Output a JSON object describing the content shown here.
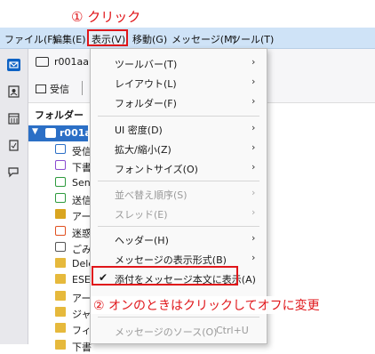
{
  "annotations": {
    "step1": "① クリック",
    "step2": "② オンのときはクリックしてオフに変更"
  },
  "menubar": {
    "file": "ファイル(F)",
    "edit": "編集(E)",
    "view": "表示(V)",
    "go": "移動(G)",
    "message": "メッセージ(M)",
    "tools": "ツール(T)"
  },
  "toolbar": {
    "account": "r001aa(",
    "get_messages": "受信"
  },
  "folders": {
    "header": "フォルダー",
    "account": "r001aa",
    "items": [
      {
        "label": "受信",
        "icon": "inbox-icon"
      },
      {
        "label": "下書",
        "icon": "drafts-icon"
      },
      {
        "label": "Sen",
        "icon": "sent-icon"
      },
      {
        "label": "送信",
        "icon": "sent-icon"
      },
      {
        "label": "アー",
        "icon": "archive-icon"
      },
      {
        "label": "迷惑",
        "icon": "junk-icon"
      },
      {
        "label": "ごみ",
        "icon": "trash-icon"
      },
      {
        "label": "Dele",
        "icon": "folder-icon"
      },
      {
        "label": "ESE",
        "icon": "folder-icon"
      },
      {
        "label": "アー",
        "icon": "folder-icon"
      },
      {
        "label": "ジャ",
        "icon": "folder-icon"
      },
      {
        "label": "フィ",
        "icon": "folder-icon"
      },
      {
        "label": "下書",
        "icon": "folder-icon"
      }
    ]
  },
  "view_menu": {
    "toolbar": "ツールバー(T)",
    "layout": "レイアウト(L)",
    "folder": "フォルダー(F)",
    "ui_density": "UI 密度(D)",
    "zoom": "拡大/縮小(Z)",
    "font_size": "フォントサイズ(O)",
    "sort": "並べ替え順序(S)",
    "threads": "スレッド(E)",
    "headers": "ヘッダー(H)",
    "body_as": "メッセージの表示形式(B)",
    "attachments_inline": "添付をメッセージ本文に表示(A)",
    "source": "メッセージのソース(O)",
    "source_shortcut": "Ctrl+U"
  },
  "colors": {
    "accent_red": "#e0161a",
    "selection_blue": "#2b6fc6",
    "menubar_bg": "#cfe3f7"
  }
}
